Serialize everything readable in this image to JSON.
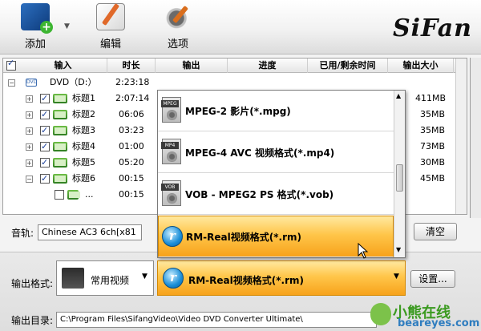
{
  "toolbar": {
    "add_label": "添加",
    "edit_label": "编辑",
    "options_label": "选项",
    "logo": "SiFan"
  },
  "table": {
    "columns": [
      "输入",
      "时长",
      "输出",
      "进度",
      "已用/剩余时间",
      "输出大小"
    ],
    "disc": {
      "label": "DVD（D:）",
      "duration": "2:23:18"
    },
    "rows": [
      {
        "label": "标题1",
        "duration": "2:07:14",
        "size": "411MB",
        "checked": true
      },
      {
        "label": "标题2",
        "duration": "06:06",
        "size": "35MB",
        "checked": true
      },
      {
        "label": "标题3",
        "duration": "03:23",
        "size": "35MB",
        "checked": true
      },
      {
        "label": "标题4",
        "duration": "01:00",
        "size": "73MB",
        "checked": true
      },
      {
        "label": "标题5",
        "duration": "05:20",
        "size": "30MB",
        "checked": true
      },
      {
        "label": "标题6",
        "duration": "00:15",
        "size": "45MB",
        "checked": true
      },
      {
        "label": "...",
        "duration": "00:15",
        "size": "",
        "checked": false
      }
    ]
  },
  "audio": {
    "label": "音轨:",
    "value": "Chinese AC3 6ch[x81",
    "clear_label": "清空"
  },
  "output": {
    "format_label": "输出格式:",
    "category": "常用视频",
    "format": "RM-Real视频格式(*.rm)",
    "settings_label": "设置...",
    "dir_label": "输出目录:",
    "dir": "C:\\Program Files\\SifangVideo\\Video DVD Converter Ultimate\\"
  },
  "dropdown": {
    "options": [
      {
        "tag": "MPEG",
        "label": "MPEG-2 影片(*.mpg)"
      },
      {
        "tag": "MP4",
        "label": "MPEG-4 AVC 视频格式(*.mp4)"
      },
      {
        "tag": "VOB",
        "label": "VOB - MPEG2 PS 格式(*.vob)"
      },
      {
        "tag": "",
        "label": "RM-Real视频格式(*.rm)"
      }
    ]
  },
  "watermark": {
    "cn": "小熊在线",
    "en": "beareyes.com"
  },
  "colors": {
    "highlight": "#ffc64a",
    "accent_blue": "#1a8ed8"
  }
}
